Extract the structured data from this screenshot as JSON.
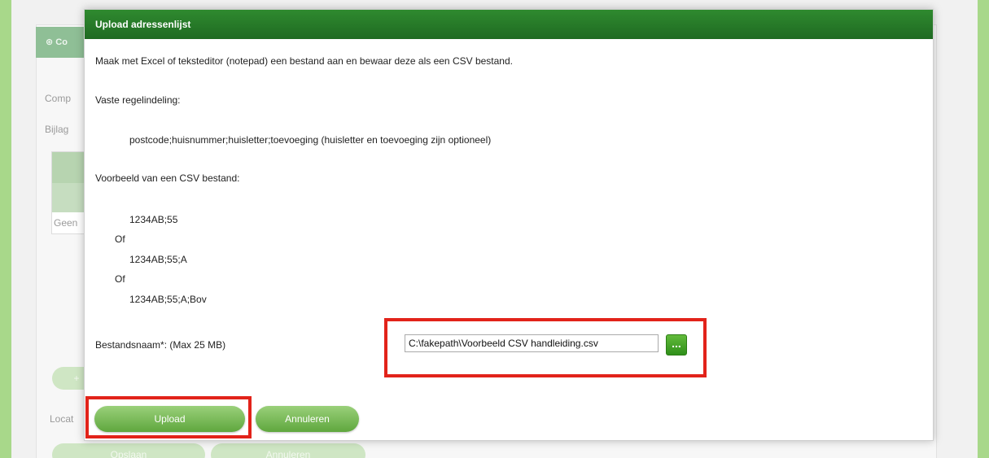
{
  "background": {
    "collapse_tab_label": "Co",
    "label_comp": "Comp",
    "label_bijlage": "Bijlag",
    "label_geen": "Geen",
    "label_locat": "Locat",
    "add_button_label": "+",
    "save_button_label": "Opslaan",
    "cancel_button_label": "Annuleren"
  },
  "modal": {
    "title": "Upload adressenlijst",
    "intro": "Maak met Excel of teksteditor (notepad) een bestand aan en bewaar deze als een CSV bestand.",
    "fixed_format_label": "Vaste regelindeling:",
    "fixed_format": "postcode;huisnummer;huisletter;toevoeging (huisletter en toevoeging zijn optioneel)",
    "example_label": "Voorbeeld van een CSV bestand:",
    "examples": [
      "1234AB;55",
      "1234AB;55;A",
      "1234AB;55;A;Bov"
    ],
    "or_label": "Of",
    "file_label": "Bestandsnaam*: (Max 25 MB)",
    "file_value": "C:\\fakepath\\Voorbeeld CSV handleiding.csv",
    "browse_label": "...",
    "upload_label": "Upload",
    "cancel_label": "Annuleren"
  },
  "colors": {
    "header_green": "#1f6a22",
    "button_green": "#5fa73e",
    "highlight_red": "#e2231a",
    "page_green_strip": "#a8d88a"
  }
}
